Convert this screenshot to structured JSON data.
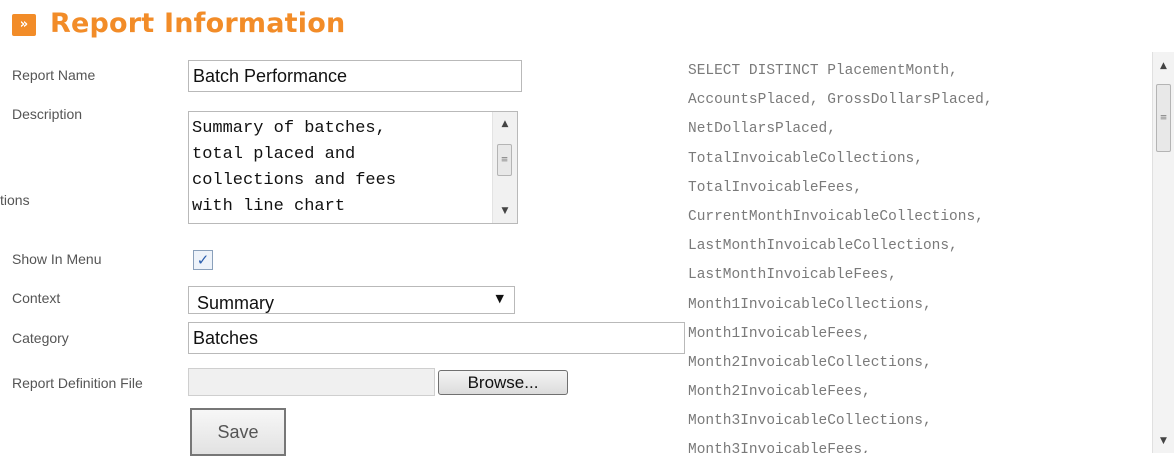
{
  "header": {
    "icon": "double-chevron-right-icon",
    "title": "Report Information"
  },
  "form": {
    "report_name": {
      "label": "Report Name",
      "value": "Batch Performance"
    },
    "description": {
      "label": "Description",
      "value": "Summary of batches,\ntotal placed and\ncollections and fees\nwith line chart"
    },
    "truncated_label": "tions",
    "show_in_menu": {
      "label": "Show In Menu",
      "checked": true,
      "check_glyph": "✓"
    },
    "context": {
      "label": "Context",
      "selected": "Summary"
    },
    "category": {
      "label": "Category",
      "value": "Batches"
    },
    "report_definition_file": {
      "label": "Report Definition File",
      "button_label": "Browse..."
    },
    "save_label": "Save"
  },
  "sql_lines": [
    "SELECT DISTINCT PlacementMonth,",
    "AccountsPlaced, GrossDollarsPlaced,",
    "NetDollarsPlaced,",
    "TotalInvoicableCollections,",
    "TotalInvoicableFees,",
    "CurrentMonthInvoicableCollections,",
    "LastMonthInvoicableCollections,",
    "LastMonthInvoicableFees,",
    "Month1InvoicableCollections,",
    "Month1InvoicableFees,",
    "Month2InvoicableCollections,",
    "Month2InvoicableFees,",
    "Month3InvoicableCollections,",
    "Month3InvoicableFees,"
  ],
  "colors": {
    "accent": "#f28c28",
    "sql_text": "#7a7a7a"
  }
}
